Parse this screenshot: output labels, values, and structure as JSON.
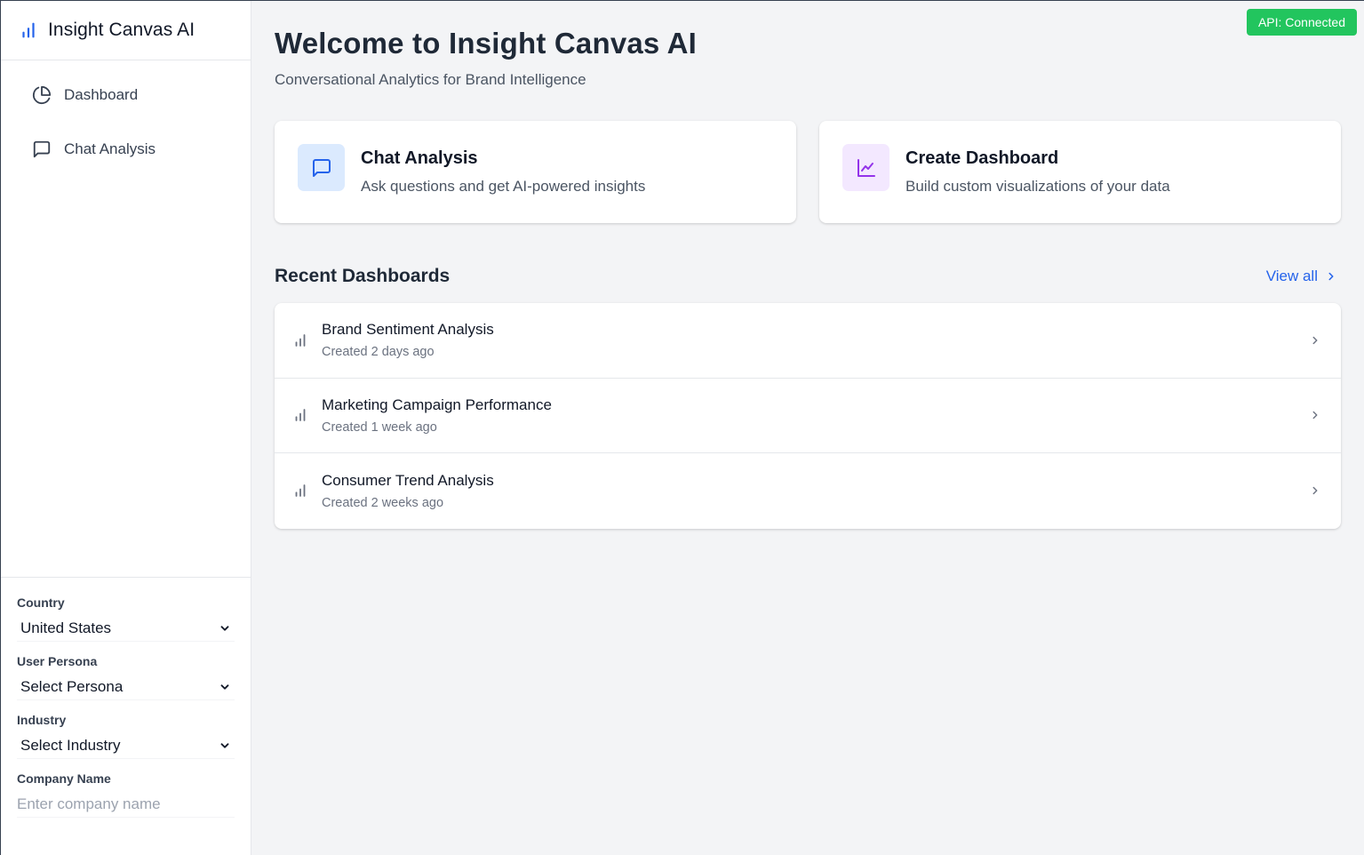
{
  "app": {
    "title": "Insight Canvas AI"
  },
  "sidebar": {
    "items": [
      {
        "label": "Dashboard",
        "icon": "pie-chart-icon"
      },
      {
        "label": "Chat Analysis",
        "icon": "message-square-icon"
      }
    ],
    "filters": {
      "country": {
        "label": "Country",
        "value": "United States"
      },
      "persona": {
        "label": "User Persona",
        "value": "Select Persona"
      },
      "industry": {
        "label": "Industry",
        "value": "Select Industry"
      },
      "company": {
        "label": "Company Name",
        "placeholder": "Enter company name",
        "value": ""
      }
    }
  },
  "status": {
    "api": "API: Connected",
    "color": "#22c55e"
  },
  "main": {
    "title": "Welcome to Insight Canvas AI",
    "subtitle": "Conversational Analytics for Brand Intelligence",
    "cards": [
      {
        "title": "Chat Analysis",
        "description": "Ask questions and get AI-powered insights",
        "icon": "message-square-icon",
        "icon_bg": "#dbeafe",
        "icon_color": "#2563eb"
      },
      {
        "title": "Create Dashboard",
        "description": "Build custom visualizations of your data",
        "icon": "line-chart-icon",
        "icon_bg": "#f3e8ff",
        "icon_color": "#9333ea"
      }
    ],
    "recent": {
      "title": "Recent Dashboards",
      "view_all": "View all",
      "items": [
        {
          "title": "Brand Sentiment Analysis",
          "subtitle": "Created 2 days ago",
          "icon": "bar-chart-icon"
        },
        {
          "title": "Marketing Campaign Performance",
          "subtitle": "Created 1 week ago",
          "icon": "bar-chart-icon"
        },
        {
          "title": "Consumer Trend Analysis",
          "subtitle": "Created 2 weeks ago",
          "icon": "bar-chart-icon"
        }
      ]
    }
  },
  "colors": {
    "accent": "#2563eb",
    "brand_icon": "#2563eb"
  }
}
